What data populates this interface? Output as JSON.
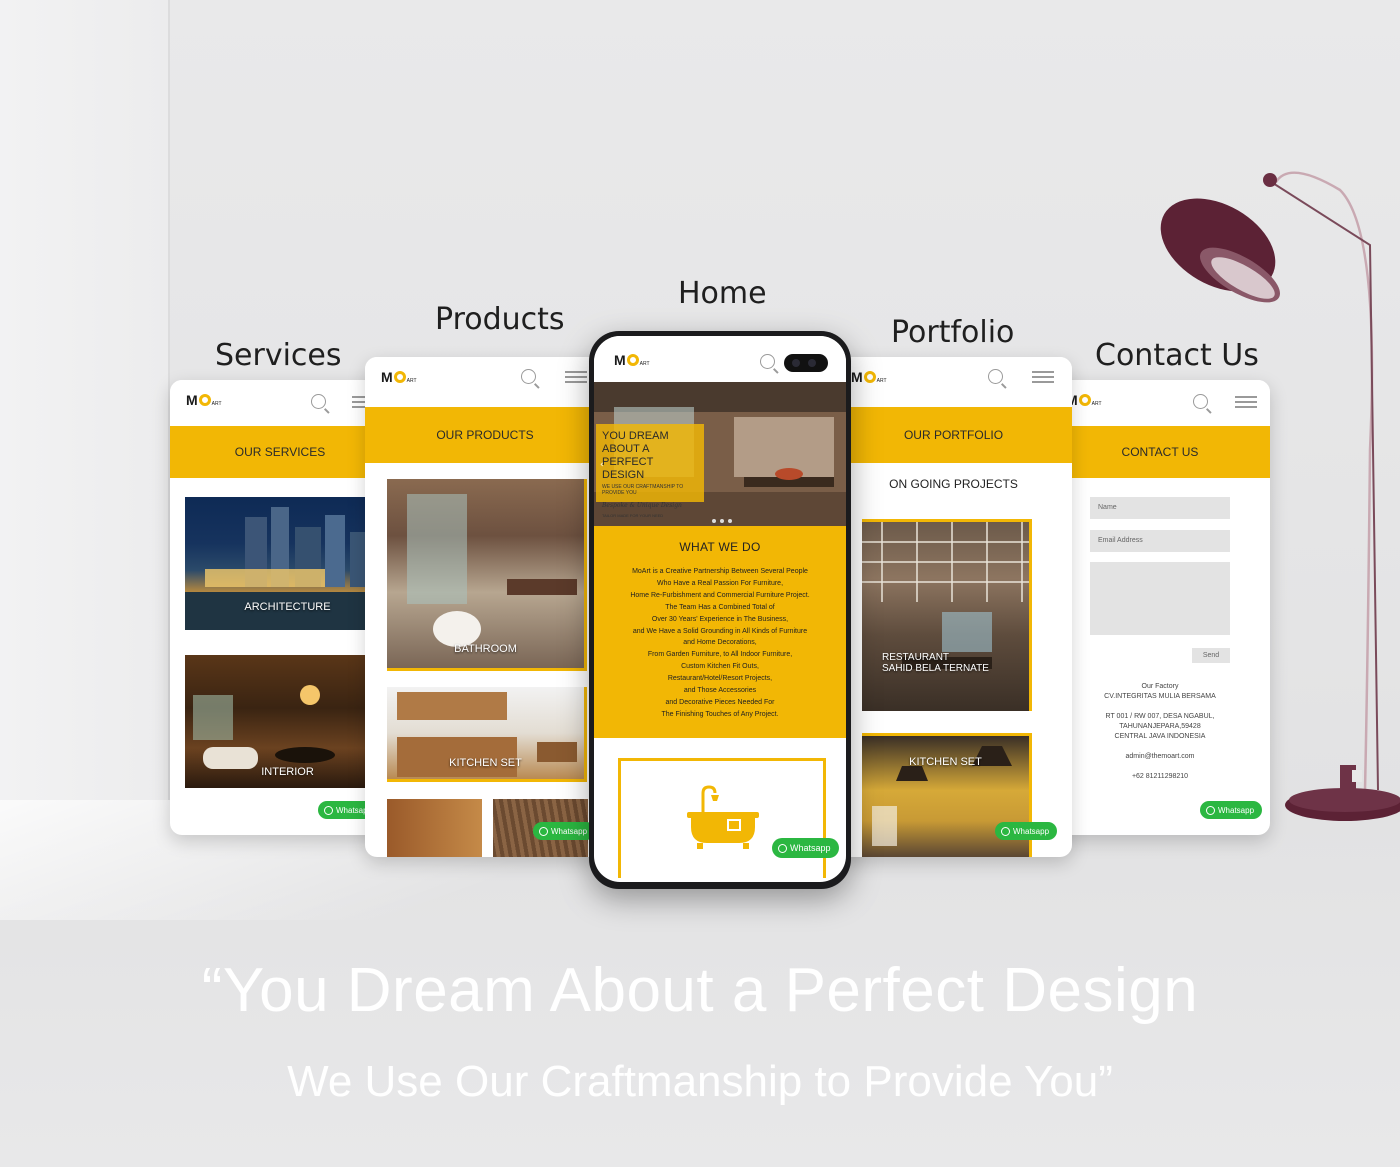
{
  "labels": {
    "services": "Services",
    "products": "Products",
    "home": "Home",
    "portfolio": "Portfolio",
    "contact": "Contact Us"
  },
  "brand": {
    "logo_text": "M",
    "logo_sub": "ART",
    "accent": "#f2b705",
    "whatsapp_green": "#2bb741"
  },
  "services_screen": {
    "banner": "OUR SERVICES",
    "items": [
      {
        "label": "ARCHITECTURE"
      },
      {
        "label": "INTERIOR"
      }
    ],
    "whatsapp": "Whatsapp"
  },
  "products_screen": {
    "banner": "OUR PRODUCTS",
    "items": [
      {
        "label": "BATHROOM"
      },
      {
        "label": "KITCHEN SET"
      }
    ],
    "whatsapp": "Whatsapp"
  },
  "home_screen": {
    "hero_title": "YOU DREAM ABOUT A PERFECT DESIGN",
    "hero_sub": "WE USE OUR CRAFTMANSHIP TO PROVIDE YOU",
    "hero_script": "Bespoke & Unique Design",
    "hero_tag": "TAILOR MADE FOR YOUR NEED",
    "section_title": "WHAT WE DO",
    "body_lines": [
      "MoArt is a Creative Partnership Between Several People",
      "Who Have a Real Passion For Furniture,",
      "Home Re-Furbishment and Commercial Furniture Project.",
      "The Team Has a Combined Total of",
      "Over 30 Years' Experience in The Business,",
      "and We Have a Solid Grounding in All Kinds of Furniture",
      "and Home Decorations,",
      "From Garden Furniture, to All Indoor Furniture,",
      "Custom Kitchen Fit Outs,",
      "Restaurant/Hotel/Resort Projects,",
      "and Those Accessories",
      "and Decorative Pieces Needed For",
      "The Finishing Touches of Any Project."
    ],
    "whatsapp": "Whatsapp"
  },
  "portfolio_screen": {
    "banner": "OUR PORTFOLIO",
    "subheading": "ON GOING PROJECTS",
    "items": [
      {
        "label_line1": "RESTAURANT",
        "label_line2": "SAHID BELA TERNATE"
      },
      {
        "label_line1": "KITCHEN SET",
        "label_line2": ""
      }
    ],
    "whatsapp": "Whatsapp"
  },
  "contact_screen": {
    "banner": "CONTACT US",
    "name_placeholder": "Name",
    "email_placeholder": "Email Address",
    "send_label": "Send",
    "address_lines": [
      "Our Factory",
      "CV.INTEGRITAS MULIA BERSAMA",
      "",
      "RT 001 / RW  007, DESA NGABUL,",
      "TAHUNANJEPARA,59428",
      "CENTRAL JAVA INDONESIA",
      "",
      "admin@themoart.com",
      "",
      "+62 81211298210"
    ],
    "whatsapp": "Whatsapp"
  },
  "tagline": {
    "line1": "“You Dream About a Perfect Design",
    "line2": "We Use Our Craftmanship to Provide You”"
  }
}
